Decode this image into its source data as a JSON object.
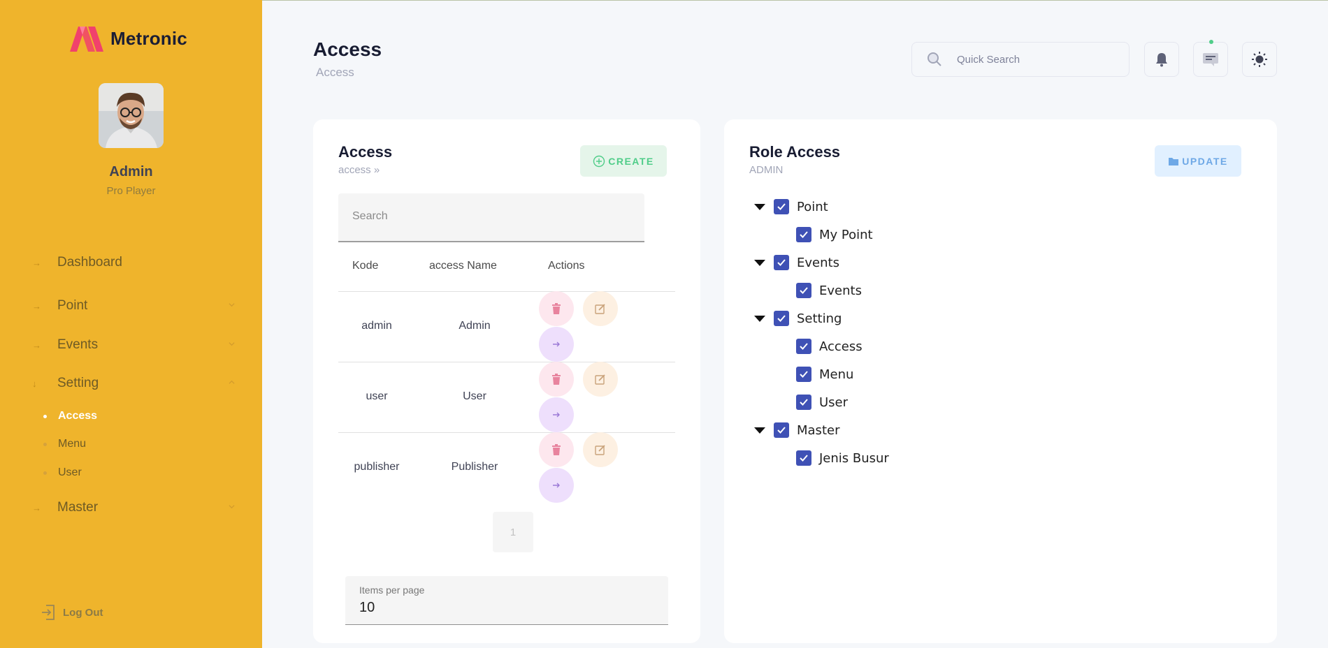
{
  "brand": {
    "name": "Metronic"
  },
  "user": {
    "name": "Admin",
    "role": "Pro Player"
  },
  "sidebar": {
    "items": [
      {
        "label": "Dashboard"
      },
      {
        "label": "Point"
      },
      {
        "label": "Events"
      },
      {
        "label": "Setting"
      },
      {
        "label": "Master"
      }
    ],
    "setting_sub": [
      {
        "label": "Access",
        "active": true
      },
      {
        "label": "Menu"
      },
      {
        "label": "User"
      }
    ],
    "logout_label": "Log Out"
  },
  "header": {
    "title": "Access",
    "breadcrumb": "Access",
    "search_placeholder": "Quick Search"
  },
  "access_card": {
    "title": "Access",
    "subtitle": "access »",
    "create_label": "CREATE",
    "search_placeholder": "Search",
    "columns": [
      "Kode",
      "access Name",
      "Actions"
    ],
    "rows": [
      {
        "kode": "admin",
        "name": "Admin"
      },
      {
        "kode": "user",
        "name": "User"
      },
      {
        "kode": "publisher",
        "name": "Publisher"
      }
    ],
    "page": "1",
    "items_per_page_label": "Items per page",
    "items_per_page_value": "10"
  },
  "role_card": {
    "title": "Role Access",
    "subtitle": "ADMIN",
    "update_label": "UPDATE",
    "tree": [
      {
        "label": "Point",
        "children": [
          "My Point"
        ]
      },
      {
        "label": "Events",
        "children": [
          "Events"
        ]
      },
      {
        "label": "Setting",
        "children": [
          "Access",
          "Menu",
          "User"
        ]
      },
      {
        "label": "Master",
        "children": [
          "Jenis Busur"
        ]
      }
    ]
  },
  "colors": {
    "sidebar": "#efb42c",
    "checkbox": "#3f51b5",
    "create": "#50cd89",
    "update": "#6ea8e6"
  }
}
